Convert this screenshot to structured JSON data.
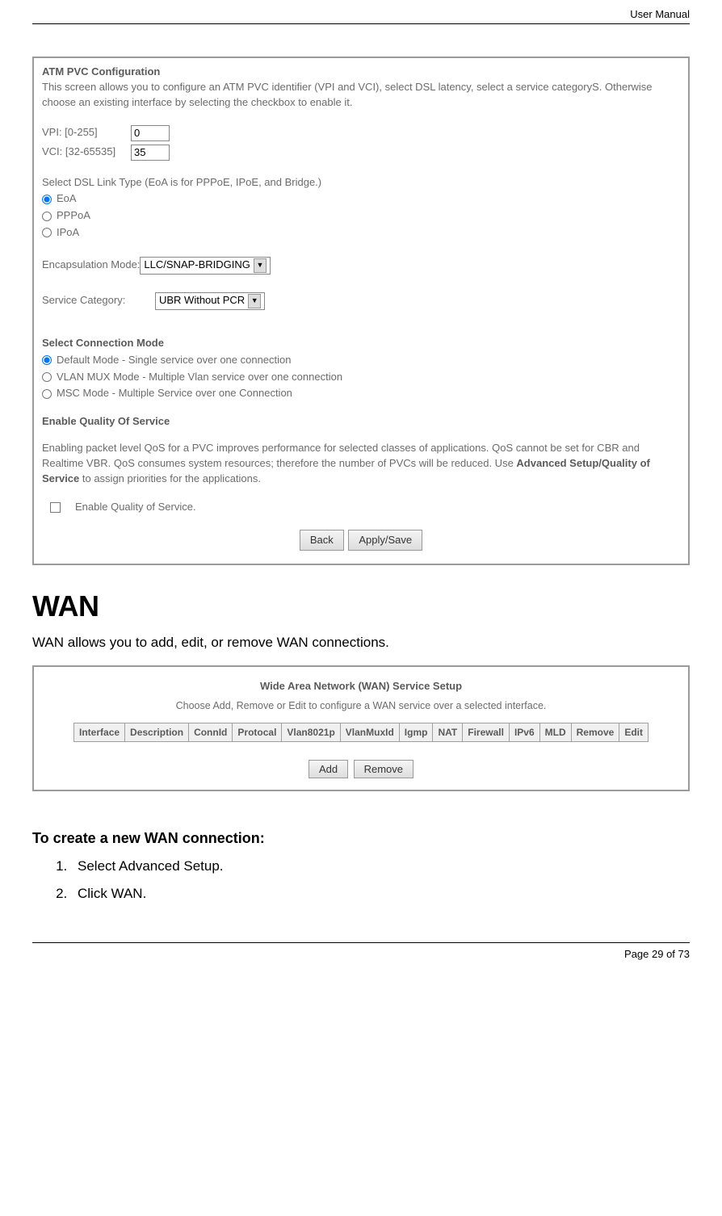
{
  "header": {
    "doc_type": "User Manual"
  },
  "atm_panel": {
    "title": "ATM PVC Configuration",
    "intro": "This screen allows you to configure an ATM PVC identifier (VPI and VCI), select DSL latency, select a service categoryS. Otherwise choose an existing interface by selecting the checkbox to enable it.",
    "vpi_label": "VPI: [0-255]",
    "vpi_value": "0",
    "vci_label": "VCI: [32-65535]",
    "vci_value": "35",
    "dsl_link_label": "Select DSL Link Type (EoA is for PPPoE, IPoE, and Bridge.)",
    "dsl_options": [
      "EoA",
      "PPPoA",
      "IPoA"
    ],
    "encap_label": "Encapsulation Mode:",
    "encap_value": "LLC/SNAP-BRIDGING",
    "svc_cat_label": "Service Category:",
    "svc_cat_value": "UBR Without PCR",
    "conn_mode_title": "Select Connection Mode",
    "conn_modes": [
      "Default Mode - Single service over one connection",
      "VLAN MUX Mode - Multiple Vlan service over one connection",
      "MSC Mode - Multiple Service over one Connection"
    ],
    "qos_title": "Enable Quality Of Service",
    "qos_desc_pre": "Enabling packet level QoS for a PVC improves performance for selected classes of applications.  QoS cannot be set for CBR and Realtime VBR.  QoS consumes system resources; therefore the number of PVCs will be reduced. Use ",
    "qos_desc_bold": "Advanced Setup/Quality of Service",
    "qos_desc_post": " to assign priorities for the applications.",
    "qos_checkbox_label": "Enable Quality of Service.",
    "back_btn": "Back",
    "apply_btn": "Apply/Save"
  },
  "wan_section": {
    "heading": "WAN",
    "intro": "WAN allows you to add, edit, or remove WAN connections."
  },
  "wan_panel": {
    "title": "Wide Area Network (WAN) Service Setup",
    "subtitle": "Choose Add, Remove or Edit to configure a WAN service over a selected interface.",
    "columns": [
      "Interface",
      "Description",
      "ConnId",
      "Protocal",
      "Vlan8021p",
      "VlanMuxId",
      "Igmp",
      "NAT",
      "Firewall",
      "IPv6",
      "MLD",
      "Remove",
      "Edit"
    ],
    "add_btn": "Add",
    "remove_btn": "Remove"
  },
  "create_section": {
    "heading": "To create a new WAN connection:",
    "steps": [
      "Select Advanced Setup.",
      "Click WAN."
    ]
  },
  "footer": {
    "page_label": "Page 29 of 73"
  }
}
